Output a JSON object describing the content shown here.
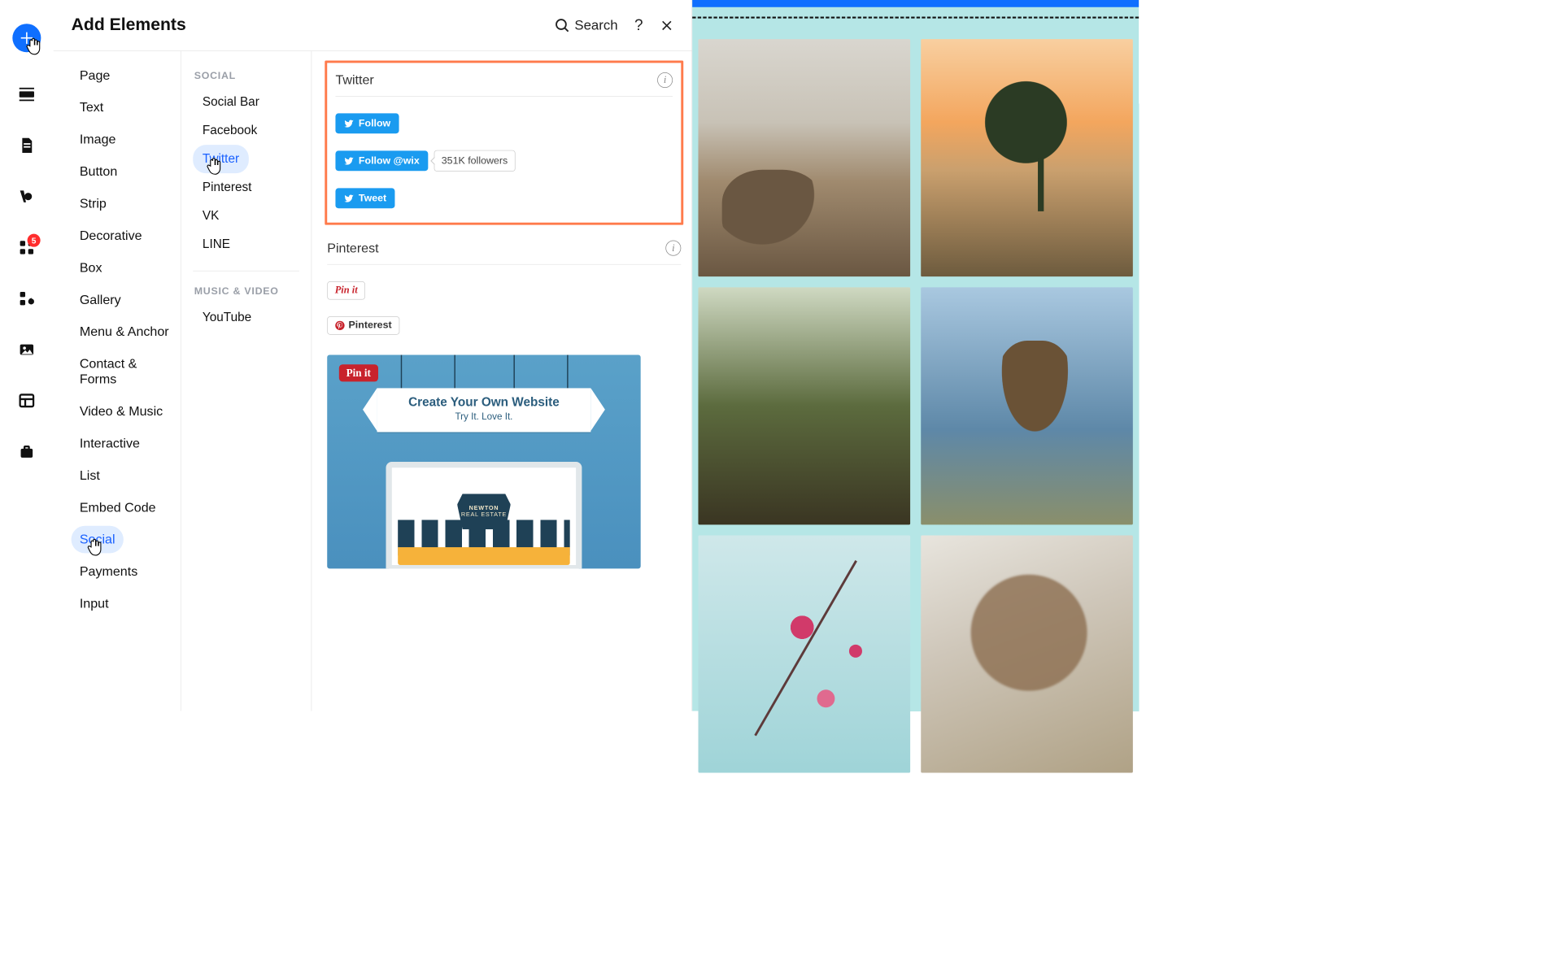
{
  "header": {
    "title": "Add Elements",
    "search_label": "Search"
  },
  "rail": {
    "badge_apps": "5"
  },
  "categories": [
    {
      "label": "Page"
    },
    {
      "label": "Text"
    },
    {
      "label": "Image"
    },
    {
      "label": "Button"
    },
    {
      "label": "Strip"
    },
    {
      "label": "Decorative"
    },
    {
      "label": "Box"
    },
    {
      "label": "Gallery"
    },
    {
      "label": "Menu & Anchor"
    },
    {
      "label": "Contact & Forms"
    },
    {
      "label": "Video & Music"
    },
    {
      "label": "Interactive"
    },
    {
      "label": "List"
    },
    {
      "label": "Embed Code"
    },
    {
      "label": "Social"
    },
    {
      "label": "Payments"
    },
    {
      "label": "Input"
    }
  ],
  "sub": {
    "group1": {
      "label": "SOCIAL",
      "items": [
        "Social Bar",
        "Facebook",
        "Twitter",
        "Pinterest",
        "VK",
        "LINE"
      ]
    },
    "group2": {
      "label": "MUSIC & VIDEO",
      "items": [
        "YouTube"
      ]
    }
  },
  "preview": {
    "twitter": {
      "title": "Twitter",
      "follow": "Follow",
      "follow_at": "Follow @wix",
      "followers": "351K followers",
      "tweet": "Tweet"
    },
    "pinterest": {
      "title": "Pinterest",
      "pinit": "Pin it",
      "pinterest_btn": "Pinterest",
      "hero": {
        "pin_overlay": "Pin it",
        "line1": "Create Your Own Website",
        "line2": "Try It. Love It.",
        "badge_top": "NEWTON",
        "badge_bottom": "REAL ESTATE"
      }
    }
  }
}
